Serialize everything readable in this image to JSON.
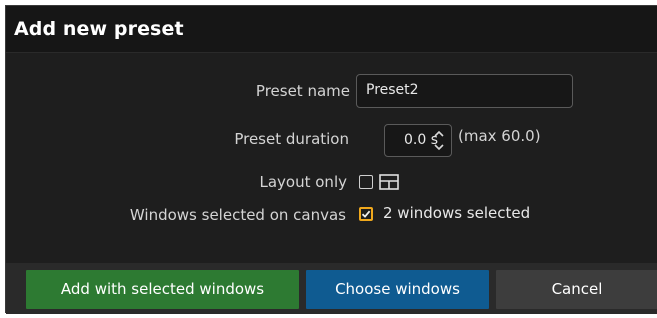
{
  "dialog": {
    "title": "Add new preset"
  },
  "form": {
    "preset_name_label": "Preset name",
    "preset_name_value": "Preset2",
    "preset_duration_label": "Preset duration",
    "preset_duration_value": "0.0 s",
    "preset_duration_max": "(max 60.0)",
    "layout_only_label": "Layout only",
    "layout_only_checked": false,
    "windows_selected_label": "Windows selected on canvas",
    "windows_selected_checked": true,
    "windows_selected_text": "2 windows selected"
  },
  "buttons": {
    "add_selected": "Add with selected windows",
    "choose_windows": "Choose windows",
    "cancel": "Cancel"
  },
  "colors": {
    "checkbox_accent": "#f0a81c",
    "add_button": "#2d7a32",
    "choose_button": "#0f5b91",
    "cancel_button": "#3d3d3d"
  },
  "icons": {
    "layout": "layout-grid-icon",
    "spin_up": "chevron-up-icon",
    "spin_down": "chevron-down-icon",
    "check": "checkmark-icon"
  }
}
